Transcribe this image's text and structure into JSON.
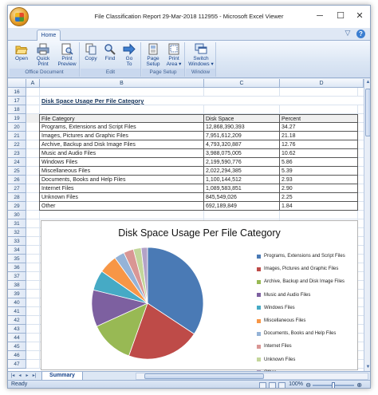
{
  "window": {
    "title": "File Classification Report 29-Mar-2018 112955 - Microsoft Excel Viewer",
    "minimize": "─",
    "maximize": "☐",
    "close": "✕"
  },
  "ribbon": {
    "tab": "Home",
    "help": "?",
    "collapse": "▽",
    "groups": {
      "office_document": "Office Document",
      "edit": "Edit",
      "page_setup": "Page Setup",
      "window": "Window"
    },
    "buttons": {
      "open": "Open",
      "quick_print_1": "Quick",
      "quick_print_2": "Print",
      "print_preview_1": "Print",
      "print_preview_2": "Preview",
      "copy": "Copy",
      "find": "Find",
      "goto_1": "Go",
      "goto_2": "To",
      "page_setup_1": "Page",
      "page_setup_2": "Setup",
      "print_area_1": "Print",
      "print_area_2": "Area ▾",
      "switch_windows_1": "Switch",
      "switch_windows_2": "Windows ▾"
    },
    "icons": [
      "open-folder-icon",
      "quick-print-icon",
      "print-preview-icon",
      "copy-icon",
      "find-icon",
      "goto-arrow-icon",
      "page-setup-icon",
      "print-area-icon",
      "switch-windows-icon"
    ]
  },
  "columns": [
    "A",
    "B",
    "C",
    "D"
  ],
  "sheet": {
    "title": "Disk Space Usage Per File Category",
    "header": [
      "File Category",
      "Disk Space",
      "Percent"
    ],
    "rows": [
      [
        "Programs, Extensions and Script Files",
        "12,868,390,393",
        "34.27"
      ],
      [
        "Images, Pictures and Graphic Files",
        "7,951,612,209",
        "21.18"
      ],
      [
        "Archive, Backup and Disk Image Files",
        "4,793,320,887",
        "12.76"
      ],
      [
        "Music and Audio Files",
        "3,988,075,005",
        "10.62"
      ],
      [
        "Windows Files",
        "2,199,590,776",
        "5.86"
      ],
      [
        "Miscellaneous Files",
        "2,022,294,385",
        "5.39"
      ],
      [
        "Documents, Books and Help Files",
        "1,100,144,512",
        "2.93"
      ],
      [
        "Internet Files",
        "1,089,583,851",
        "2.90"
      ],
      [
        "Unknown Files",
        "845,549,026",
        "2.25"
      ],
      [
        "Other",
        "692,189,849",
        "1.84"
      ]
    ],
    "row_numbers": [
      "16",
      "17",
      "18",
      "19",
      "20",
      "21",
      "22",
      "23",
      "24",
      "25",
      "26",
      "27",
      "28",
      "29",
      "30",
      "31",
      "32",
      "33",
      "34",
      "35",
      "36",
      "37",
      "38",
      "39",
      "40",
      "41",
      "42",
      "43",
      "44",
      "45",
      "46",
      "47"
    ]
  },
  "chart_data": {
    "type": "pie",
    "title": "Disk Space Usage Per File Category",
    "categories": [
      "Programs, Extensions and Script Files",
      "Images, Pictures and Graphic Files",
      "Archive, Backup and Disk Image  Files",
      "Music and Audio Files",
      "Windows Files",
      "Miscellaneous Files",
      "Documents, Books and Help Files",
      "Internet Files",
      "Unknown Files",
      "Other"
    ],
    "values": [
      34.27,
      21.18,
      12.76,
      10.62,
      5.86,
      5.39,
      2.93,
      2.9,
      2.25,
      1.84
    ],
    "colors": [
      "#4a7ab5",
      "#be4b48",
      "#98b954",
      "#7d60a0",
      "#46aac5",
      "#f79646",
      "#95b3d7",
      "#d99694",
      "#c3d69b",
      "#b3a2c7"
    ],
    "legend": "right"
  },
  "sheet_tabs": {
    "active": "Summary",
    "nav": [
      "|◂",
      "◂",
      "▸",
      "▸|"
    ]
  },
  "status": {
    "text": "Ready",
    "zoom": "100%",
    "minus": "⊖",
    "plus": "⊕"
  }
}
